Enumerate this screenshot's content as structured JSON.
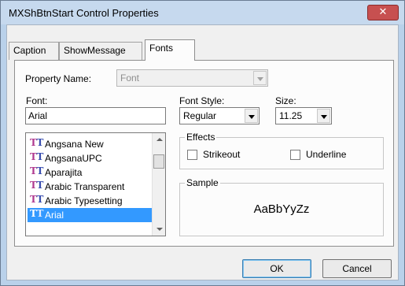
{
  "window": {
    "title": "MXShBtnStart Control Properties",
    "close_symbol": "✕"
  },
  "tabs": [
    {
      "label": "Caption",
      "active": false
    },
    {
      "label": "ShowMessage",
      "active": false
    },
    {
      "label": "Fonts",
      "active": true
    }
  ],
  "property_name": {
    "label": "Property Name:",
    "value": "Font"
  },
  "font": {
    "label": "Font:",
    "value": "Arial",
    "list": [
      {
        "name": "Angsana New",
        "icon": "truetype-icon"
      },
      {
        "name": "AngsanaUPC",
        "icon": "truetype-icon"
      },
      {
        "name": "Aparajita",
        "icon": "truetype-icon"
      },
      {
        "name": "Arabic Transparent",
        "icon": "truetype-icon"
      },
      {
        "name": "Arabic Typesetting",
        "icon": "truetype-icon"
      },
      {
        "name": "Arial",
        "icon": "truetype-icon",
        "selected": true
      }
    ]
  },
  "font_style": {
    "label": "Font Style:",
    "value": "Regular"
  },
  "size": {
    "label": "Size:",
    "value": "11.25"
  },
  "effects": {
    "title": "Effects",
    "strikeout_label": "Strikeout",
    "underline_label": "Underline",
    "strikeout_checked": false,
    "underline_checked": false
  },
  "sample": {
    "title": "Sample",
    "text": "AaBbYyZz"
  },
  "buttons": {
    "ok": "OK",
    "cancel": "Cancel"
  },
  "colors": {
    "selection": "#3399ff",
    "titlebar": "#c6d9ee",
    "close": "#c75050"
  }
}
